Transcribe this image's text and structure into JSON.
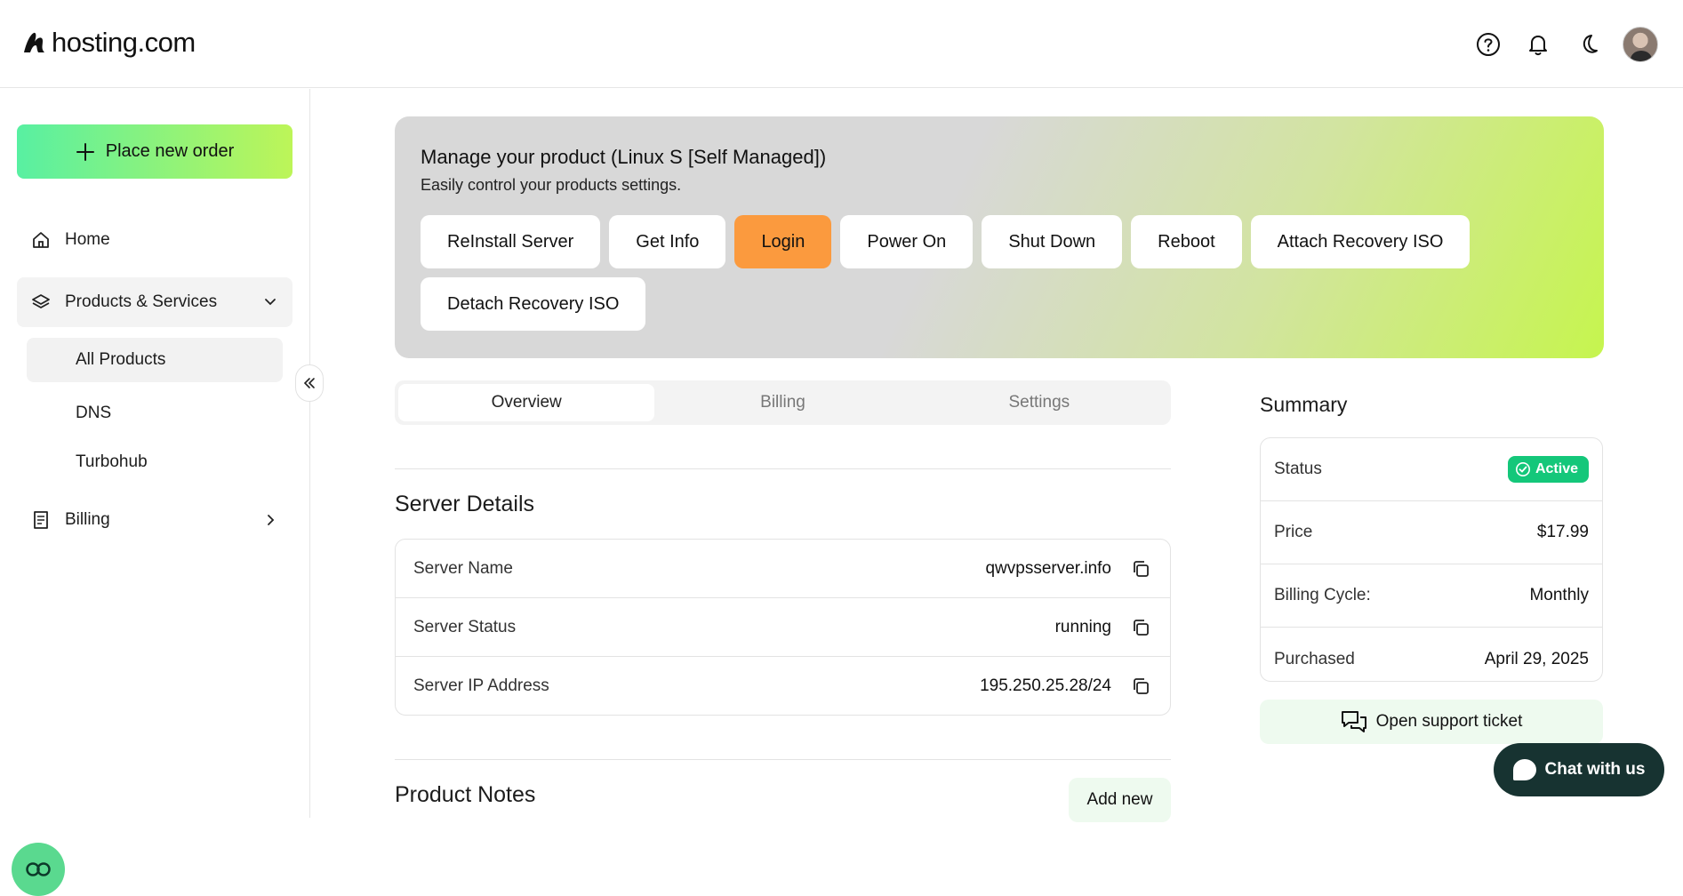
{
  "brand": {
    "name": "hosting.com"
  },
  "header": {
    "icons": [
      "help-icon",
      "bell-icon",
      "moon-icon"
    ],
    "avatar": "user-avatar"
  },
  "sidebar": {
    "order_button": "Place new order",
    "items": [
      {
        "label": "Home",
        "icon": "home-icon"
      },
      {
        "label": "Products & Services",
        "icon": "layers-icon",
        "expanded": true
      },
      {
        "label": "Billing",
        "icon": "receipt-icon"
      }
    ],
    "sub_items": [
      "All Products",
      "DNS",
      "Turbohub"
    ]
  },
  "hero": {
    "title": "Manage your product (Linux S [Self Managed])",
    "subtitle": "Easily control your products settings.",
    "buttons": [
      "ReInstall Server",
      "Get Info",
      "Login",
      "Power On",
      "Shut Down",
      "Reboot",
      "Attach Recovery ISO",
      "Detach Recovery ISO"
    ]
  },
  "tabs": [
    "Overview",
    "Billing",
    "Settings"
  ],
  "server_details": {
    "title": "Server Details",
    "rows": [
      {
        "label": "Server Name",
        "value": "qwvpsserver.info"
      },
      {
        "label": "Server Status",
        "value": "running"
      },
      {
        "label": "Server IP Address",
        "value": "195.250.25.28/24"
      }
    ]
  },
  "product_notes": {
    "title": "Product Notes",
    "add_label": "Add new"
  },
  "summary": {
    "title": "Summary",
    "status_label": "Status",
    "status_value": "Active",
    "price_label": "Price",
    "price_value": "$17.99",
    "cycle_label": "Billing Cycle:",
    "cycle_value": "Monthly",
    "purchased_label": "Purchased",
    "purchased_value": "April 29, 2025",
    "support_label": "Open support ticket"
  },
  "chat": {
    "label": "Chat with us"
  },
  "colors": {
    "accent_orange": "#fb9a3e",
    "active_green": "#14c77a",
    "chat_dark": "#173331"
  }
}
